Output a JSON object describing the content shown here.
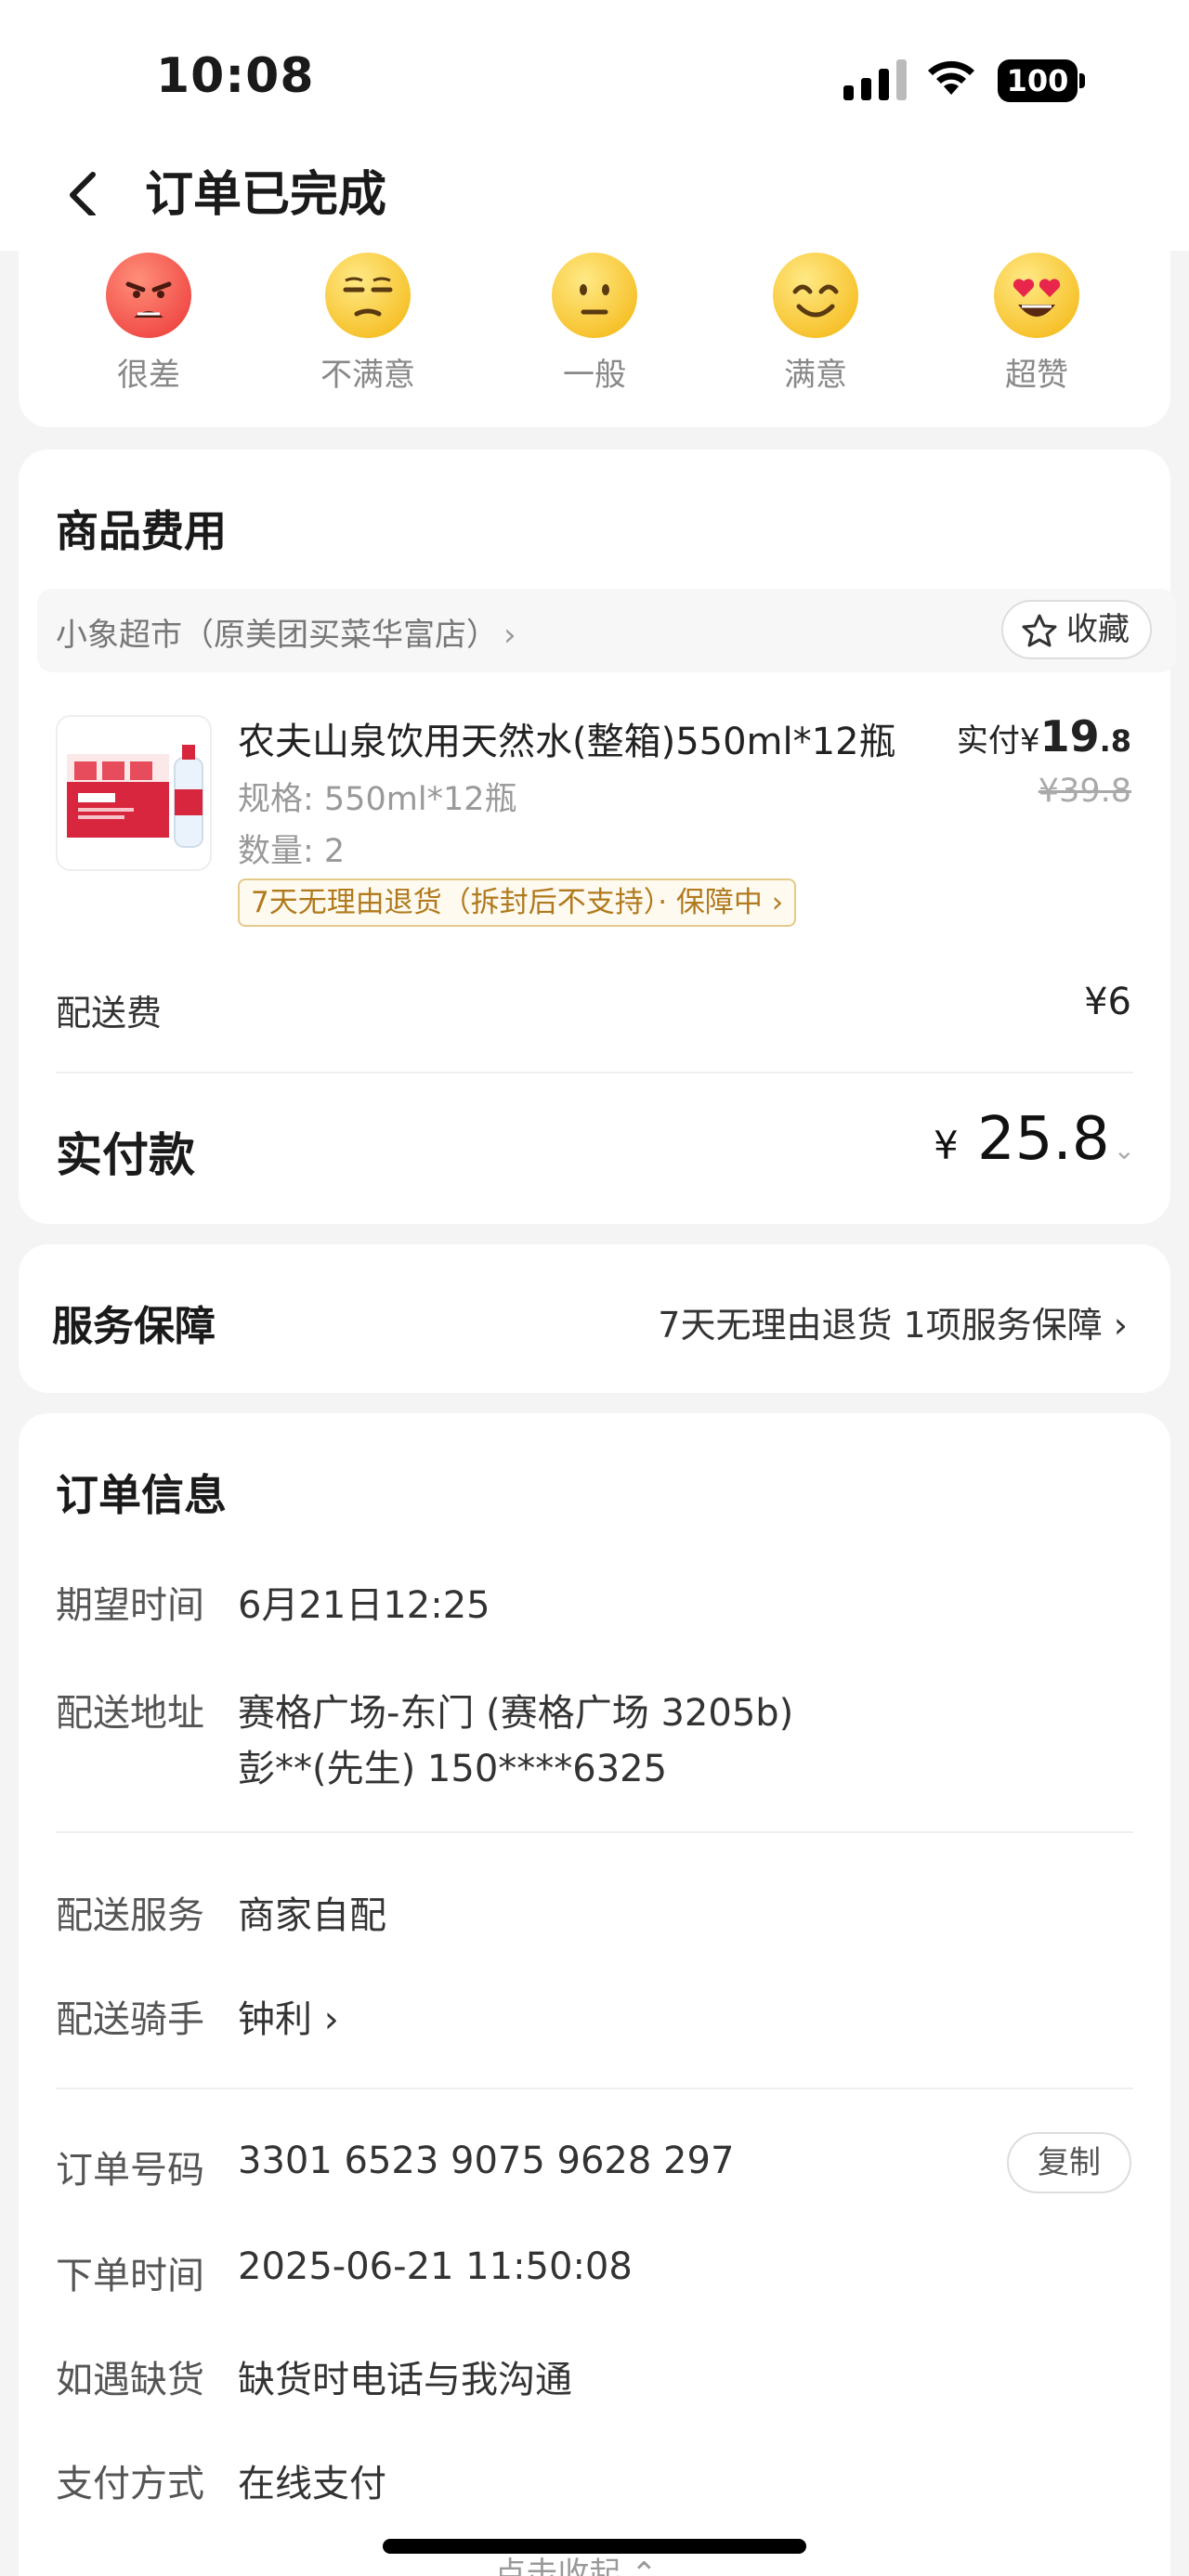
{
  "status_bar": {
    "time": "10:08",
    "battery": "100"
  },
  "nav": {
    "title": "订单已完成"
  },
  "rating": {
    "items": [
      {
        "label": "很差",
        "icon": "angry-face-icon"
      },
      {
        "label": "不满意",
        "icon": "unamused-face-icon"
      },
      {
        "label": "一般",
        "icon": "neutral-face-icon"
      },
      {
        "label": "满意",
        "icon": "smiling-face-icon"
      },
      {
        "label": "超赞",
        "icon": "heart-eyes-face-icon"
      }
    ]
  },
  "fees": {
    "title": "商品费用",
    "store_name": "小象超市（原美团买菜华富店）",
    "store_arrow": "›",
    "favorite_label": "收藏",
    "product": {
      "name": "农夫山泉饮用天然水(整箱)550ml*12瓶",
      "spec": "规格: 550ml*12瓶",
      "quantity": "数量: 2",
      "service_tag": "7天无理由退货（拆封后不支持）· 保障中 ›",
      "paid_label": "实付",
      "paid_currency": "¥",
      "paid_int": "19",
      "paid_dec": ".8",
      "original_price": "¥39.8"
    },
    "delivery_fee_label": "配送费",
    "delivery_fee_value": "¥6",
    "total_label": "实付款",
    "total_currency": "¥",
    "total_value": "25.8",
    "total_chevron": "⌄"
  },
  "guarantee": {
    "title": "服务保障",
    "value": "7天无理由退货 1项服务保障 ›"
  },
  "order_info": {
    "title": "订单信息",
    "expected_time_label": "期望时间",
    "expected_time_value": "6月21日12:25",
    "address_label": "配送地址",
    "address_line1": "赛格广场-东门 (赛格广场 3205b)",
    "address_line2": "彭**(先生) 150****6325",
    "delivery_service_label": "配送服务",
    "delivery_service_value": "商家自配",
    "rider_label": "配送骑手",
    "rider_value": "钟利 ›",
    "order_no_label": "订单号码",
    "order_no_value": "3301 6523 9075 9628 297",
    "copy_label": "复制",
    "order_time_label": "下单时间",
    "order_time_value": "2025-06-21 11:50:08",
    "out_of_stock_label": "如遇缺货",
    "out_of_stock_value": "缺货时电话与我沟通",
    "payment_label": "支付方式",
    "payment_value": "在线支付",
    "collapse_label": "点击收起 ⌃"
  },
  "colors": {
    "tag_text": "#b07a1d",
    "tag_border": "#e3c98a",
    "face_yellow": "#f7c431",
    "face_red": "#f2504a"
  }
}
